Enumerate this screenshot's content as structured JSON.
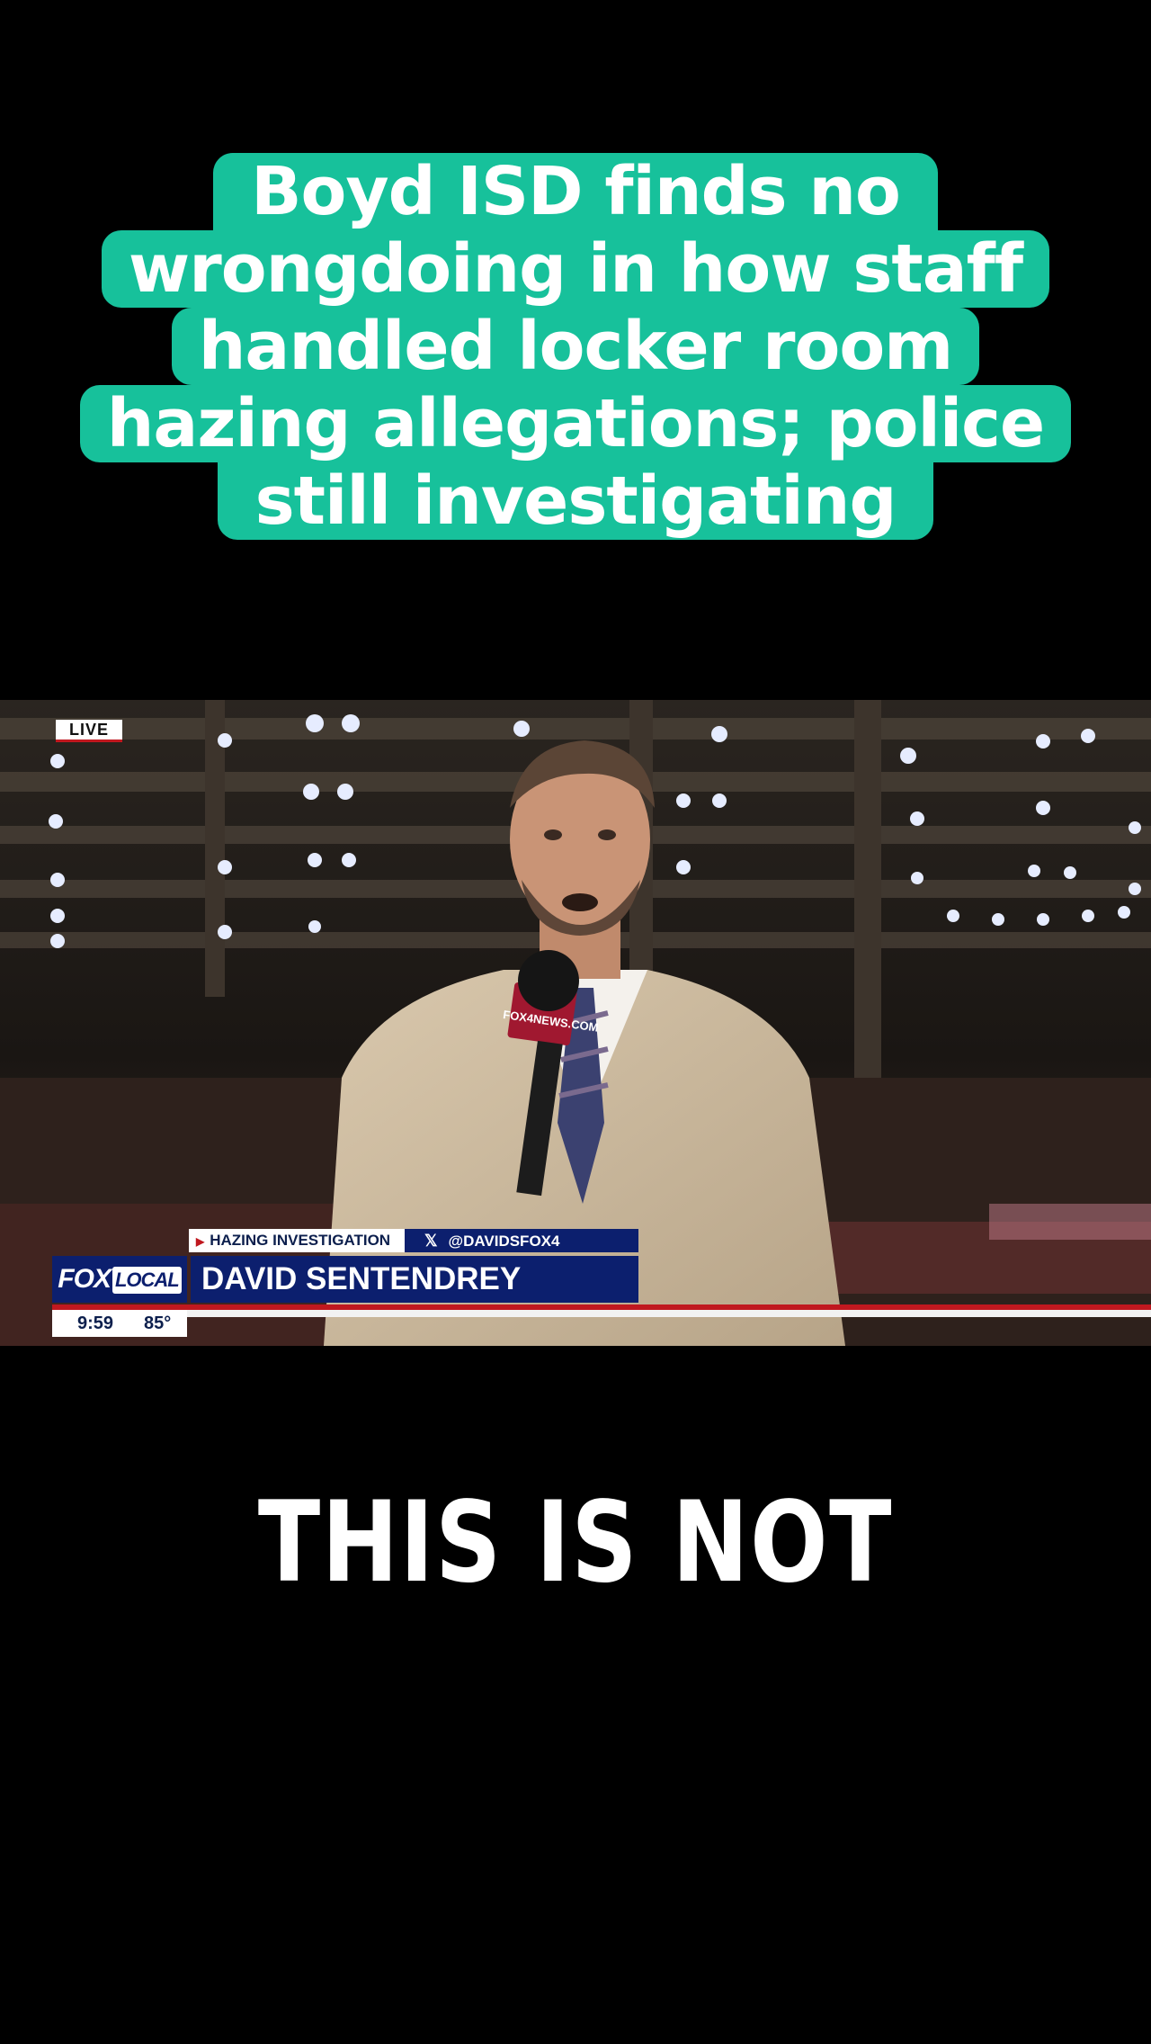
{
  "headline": {
    "lines": [
      "Boyd ISD finds no",
      "wrongdoing in how staff",
      "handled locker room",
      "hazing allegations; police",
      "still investigating"
    ],
    "background_color": "#17c19b"
  },
  "broadcast": {
    "live_label": "LIVE",
    "topic": "HAZING INVESTIGATION",
    "social_icon": "x-icon",
    "social_handle": "@DAVIDSFOX4",
    "logo_fox": "FOX",
    "logo_local": "LOCAL",
    "reporter_name": "DAVID SENTENDREY",
    "time": "9:59",
    "temperature": "85°",
    "mic_flag_text": "FOX4NEWS.COM",
    "colors": {
      "navy": "#0c1f6e",
      "red": "#c0181f"
    }
  },
  "caption": {
    "text": "THIS IS NOT"
  }
}
